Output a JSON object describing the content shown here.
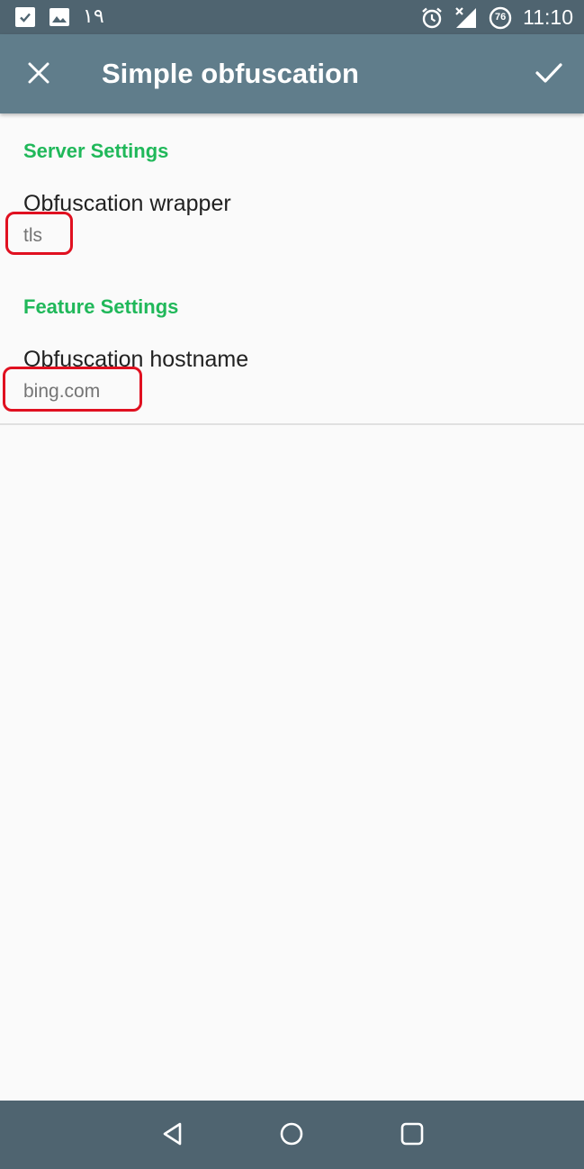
{
  "status_bar": {
    "notification_icons": [
      "check-notification-icon",
      "image-notification-icon"
    ],
    "notification_number": "١٩",
    "system_icons": [
      "alarm-icon",
      "signal-icon",
      "battery-icon"
    ],
    "battery_level": "76",
    "time": "11:10"
  },
  "app_bar": {
    "close_icon": "close-icon",
    "title": "Simple obfuscation",
    "confirm_icon": "check-icon",
    "background_color": "#607d8b"
  },
  "sections": {
    "server": {
      "header": "Server Settings",
      "items": [
        {
          "title": "Obfuscation wrapper",
          "summary": "tls"
        }
      ]
    },
    "feature": {
      "header": "Feature Settings",
      "items": [
        {
          "title": "Obfuscation hostname",
          "summary": "bing.com"
        }
      ]
    }
  },
  "colors": {
    "section_header": "#20b85a",
    "highlight": "#e01020"
  },
  "nav_bar": {
    "icons": [
      "back-icon",
      "home-icon",
      "recents-icon"
    ]
  }
}
